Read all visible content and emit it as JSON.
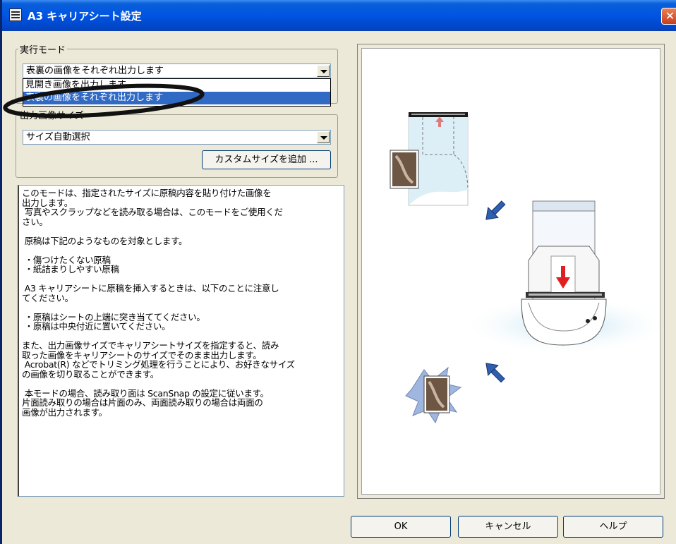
{
  "window": {
    "title": "A3 キャリアシート設定",
    "close_symbol": "✕"
  },
  "execution_mode": {
    "legend": "実行モード",
    "selected_value": "表裏の画像をそれぞれ出力します",
    "options": [
      "見開き画像を出力します",
      "表裏の画像をそれぞれ出力します"
    ]
  },
  "output_size": {
    "legend": "出力画像サイズ",
    "selected_value": "サイズ自動選択",
    "add_custom_label": "カスタムサイズを追加 ..."
  },
  "description": {
    "text": "このモードは、指定されたサイズに原稿内容を貼り付けた画像を\n出力します。\n 写真やスクラップなどを読み取る場合は、このモードをご使用くだ\nさい。\n\n 原稿は下記のようなものを対象とします。\n\n ・傷つけたくない原稿\n ・紙詰まりしやすい原稿\n\n A3 キャリアシートに原稿を挿入するときは、以下のことに注意し\nてください。\n\n ・原稿はシートの上端に突き当ててください。\n ・原稿は中央付近に置いてください。\n\nまた、出力画像サイズでキャリアシートサイズを指定すると、読み\n取った画像をキャリアシートのサイズでそのまま出力します。\n Acrobat(R) などでトリミング処理を行うことにより、お好きなサイズ\nの画像を切り取ることができます。\n\n 本モードの場合、読み取り面は ScanSnap の設定に従います。\n片面読み取りの場合は片面のみ、両面読み取りの場合は両面の\n画像が出力されます。"
  },
  "buttons": {
    "ok": "OK",
    "cancel": "キャンセル",
    "help": "ヘルプ"
  },
  "colors": {
    "accent_blue": "#2f5fb0",
    "arrow_red": "#e02020",
    "highlight": "#316ac5"
  }
}
